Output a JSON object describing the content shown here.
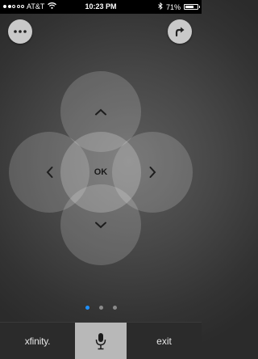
{
  "status_bar": {
    "carrier": "AT&T",
    "time": "10:23 PM",
    "battery": "71%",
    "battery_level": 0.71,
    "signal_bars": 2,
    "signal_total": 5
  },
  "top_buttons": {
    "menu_icon": "ellipsis-icon",
    "share_icon": "arrow-up-right-icon"
  },
  "dpad": {
    "up": "⌃",
    "down": "⌄",
    "left": "‹",
    "right": "›",
    "ok": "OK"
  },
  "pager": {
    "count": 3,
    "active_index": 0,
    "active_color": "#1e90ff"
  },
  "bottom_bar": {
    "brand": "xfinity.",
    "mic_icon": "microphone-icon",
    "exit": "exit"
  }
}
